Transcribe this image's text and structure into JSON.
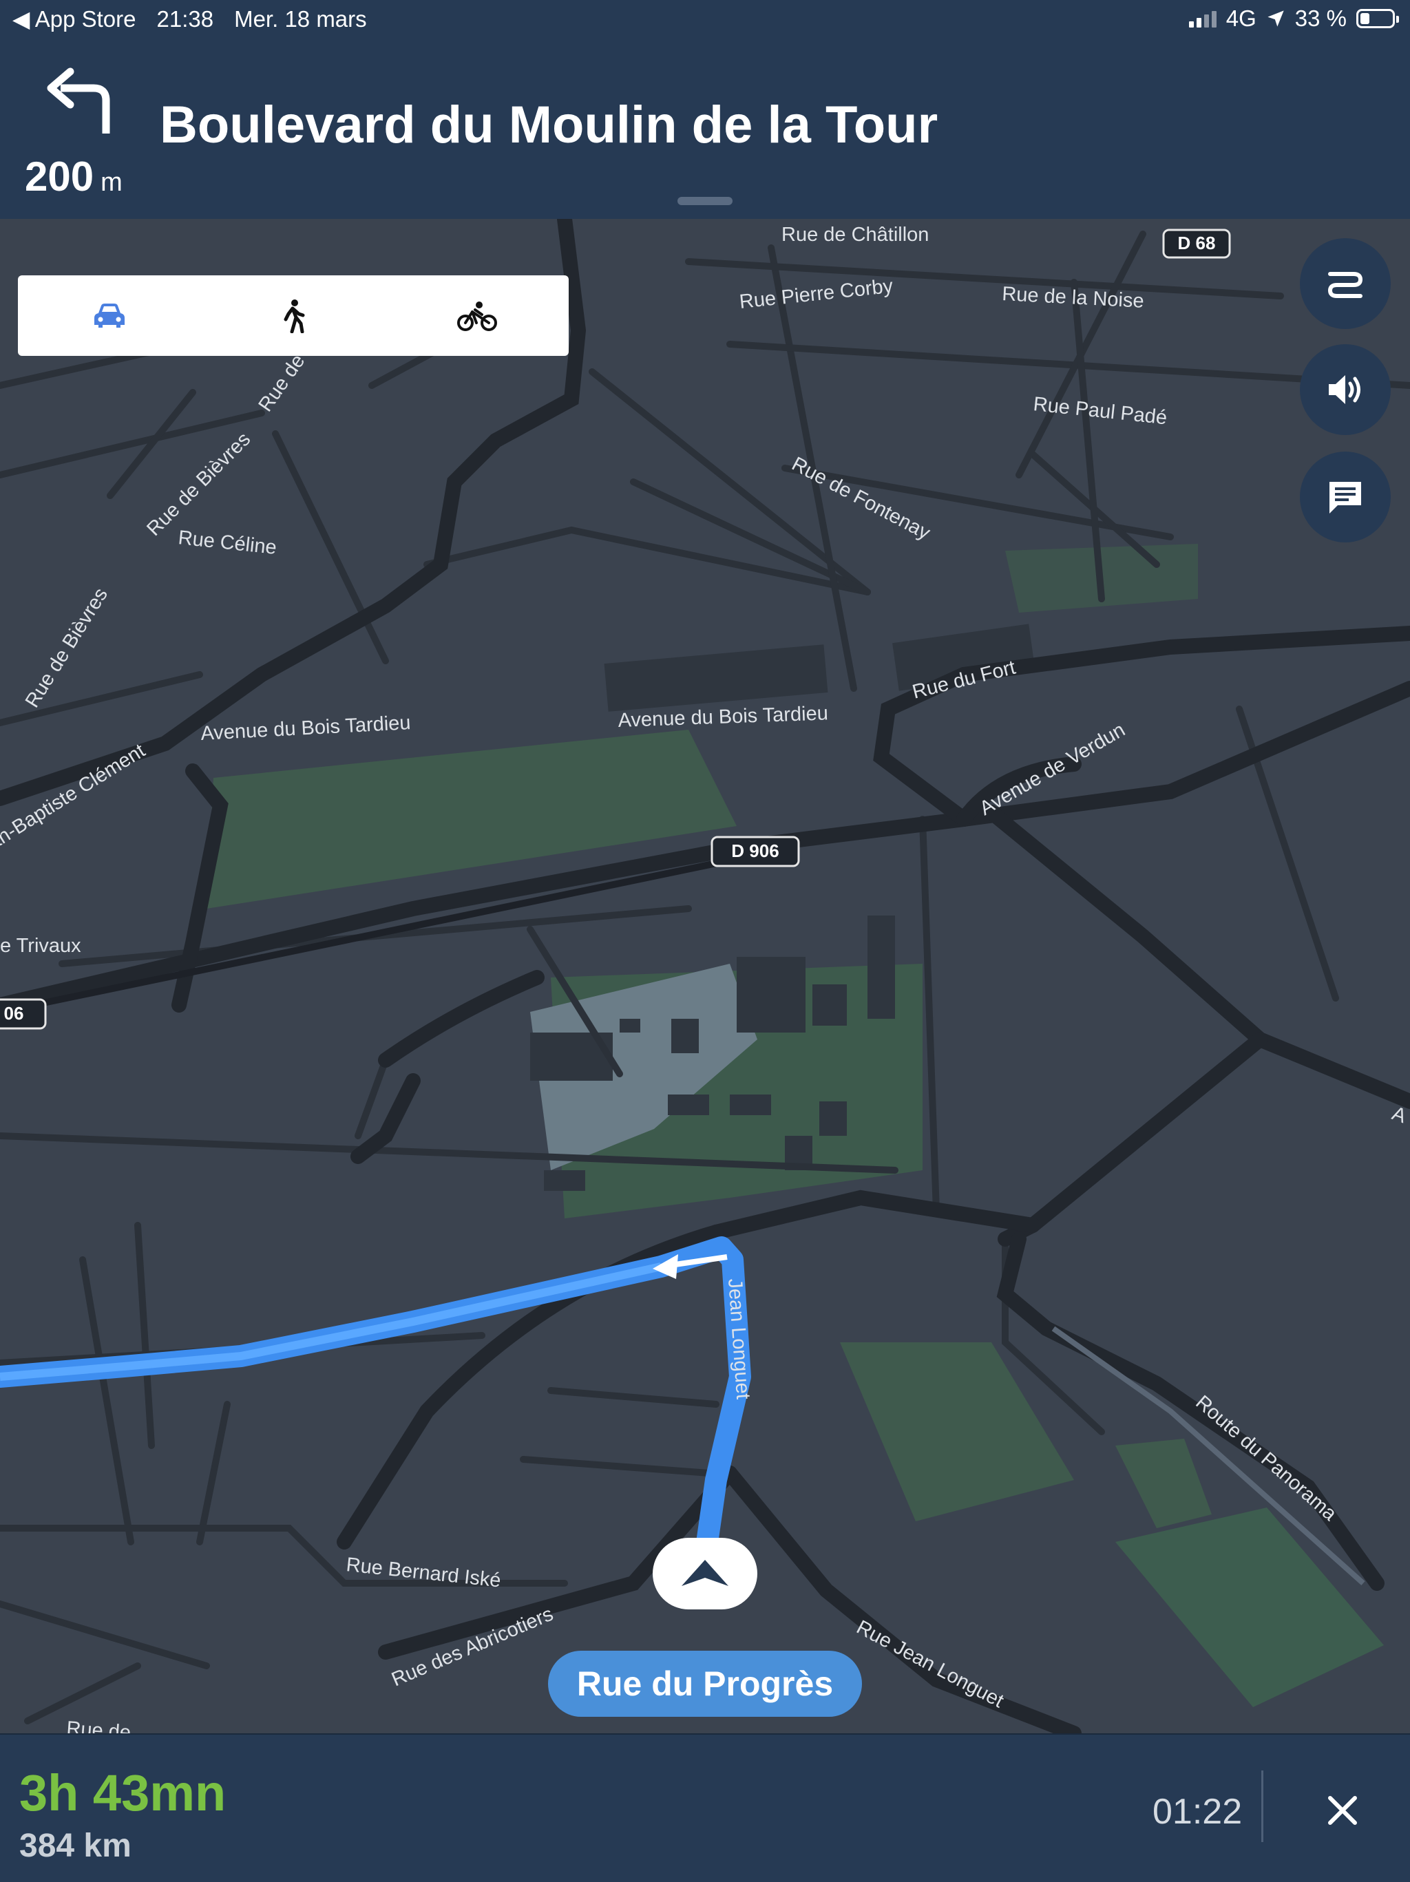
{
  "status_bar": {
    "back_app": "◀ App Store",
    "time": "21:38",
    "date": "Mer. 18 mars",
    "network": "4G",
    "battery": "33 %",
    "battery_level": 0.33
  },
  "instruction": {
    "distance_value": "200",
    "distance_unit": "m",
    "street": "Boulevard du Moulin de la Tour",
    "maneuver_icon": "turn-left-icon"
  },
  "modes": [
    {
      "label": "car",
      "icon": "car-icon",
      "active": true
    },
    {
      "label": "walk",
      "icon": "walk-icon",
      "active": false
    },
    {
      "label": "bike",
      "icon": "bike-icon",
      "active": false
    }
  ],
  "side_buttons": [
    "route-options-icon",
    "volume-icon",
    "message-icon"
  ],
  "map": {
    "streets": [
      "Rue de Châtillon",
      "Rue Pierre Corby",
      "Rue de la Noise",
      "Rue Paul Padé",
      "Rue de Fontenay",
      "Rue de Bièvres",
      "Rue Céline",
      "Rue de Bièvres",
      "Rue de Bi",
      "Avenue du Bois Tardieu",
      "Avenue du Bois Tardieu",
      "Rue du Fort",
      "Avenue de Verdun",
      "an-Baptiste Clément",
      "e Trivaux",
      "Jean Longuet",
      "Route du Panorama",
      "Rue Bernard Iské",
      "Rue des Abricotiers",
      "Rue Jean Longuet",
      "Rue de",
      "A"
    ],
    "shields": [
      "D 68",
      "D 906",
      "06"
    ],
    "current_street": "Rue du Progrès"
  },
  "trip": {
    "duration": "3h 43mn",
    "distance": "384 km",
    "arrival_time": "01:22"
  },
  "colors": {
    "header": "#263a54",
    "route": "#4a9af0",
    "eta_green": "#7ac143",
    "mode_active": "#4a7fe0"
  }
}
